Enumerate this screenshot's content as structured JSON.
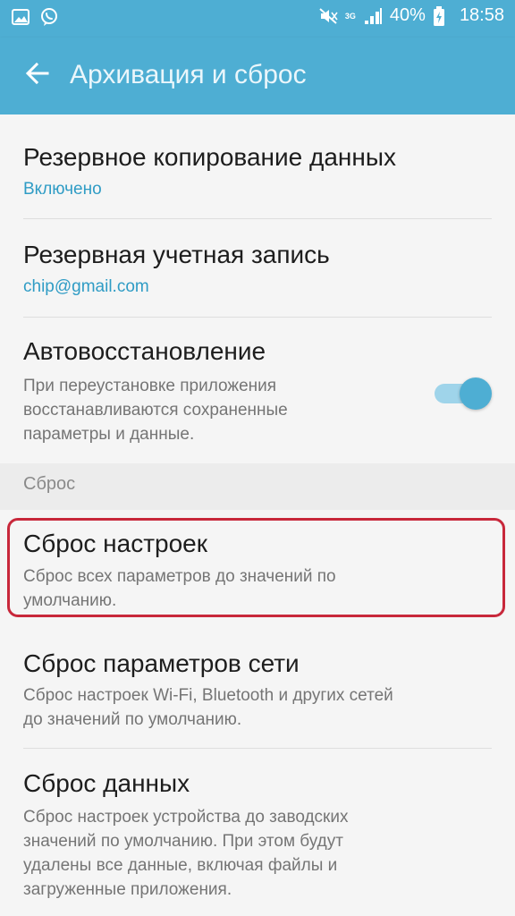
{
  "status_bar": {
    "network_type": "3G",
    "battery": "40%",
    "time": "18:58",
    "icons": [
      "gallery-icon",
      "viber-icon",
      "mute-icon",
      "signal-icon",
      "battery-charging-icon"
    ]
  },
  "app_bar": {
    "title": "Архивация и сброс",
    "back_icon": "arrow-back-icon"
  },
  "items": [
    {
      "title": "Резервное копирование данных",
      "subtitle": "Включено"
    },
    {
      "title": "Резервная учетная запись",
      "subtitle": "chip@gmail.com"
    },
    {
      "title": "Автовосстановление",
      "subtitle_lines": [
        "При переустановке приложения",
        "восстанавливаются сохраненные",
        "параметры и данные."
      ],
      "toggle_on": true
    }
  ],
  "section": {
    "label": "Сброс"
  },
  "reset_items": [
    {
      "title": "Сброс настроек",
      "subtitle_lines": [
        "Сброс всех параметров до значений по",
        "умолчанию."
      ]
    },
    {
      "title": "Сброс параметров сети",
      "subtitle_lines": [
        "Сброс настроек Wi-Fi, Bluetooth и других сетей",
        "до значений по умолчанию."
      ]
    },
    {
      "title": "Сброс данных",
      "subtitle_lines": [
        "Сброс настроек устройства до заводских",
        "значений по умолчанию. При этом будут",
        "удалены все данные, включая файлы и",
        "загруженные приложения."
      ]
    }
  ],
  "colors": {
    "accent": "#4eaed3",
    "highlight": "#c8283b"
  }
}
